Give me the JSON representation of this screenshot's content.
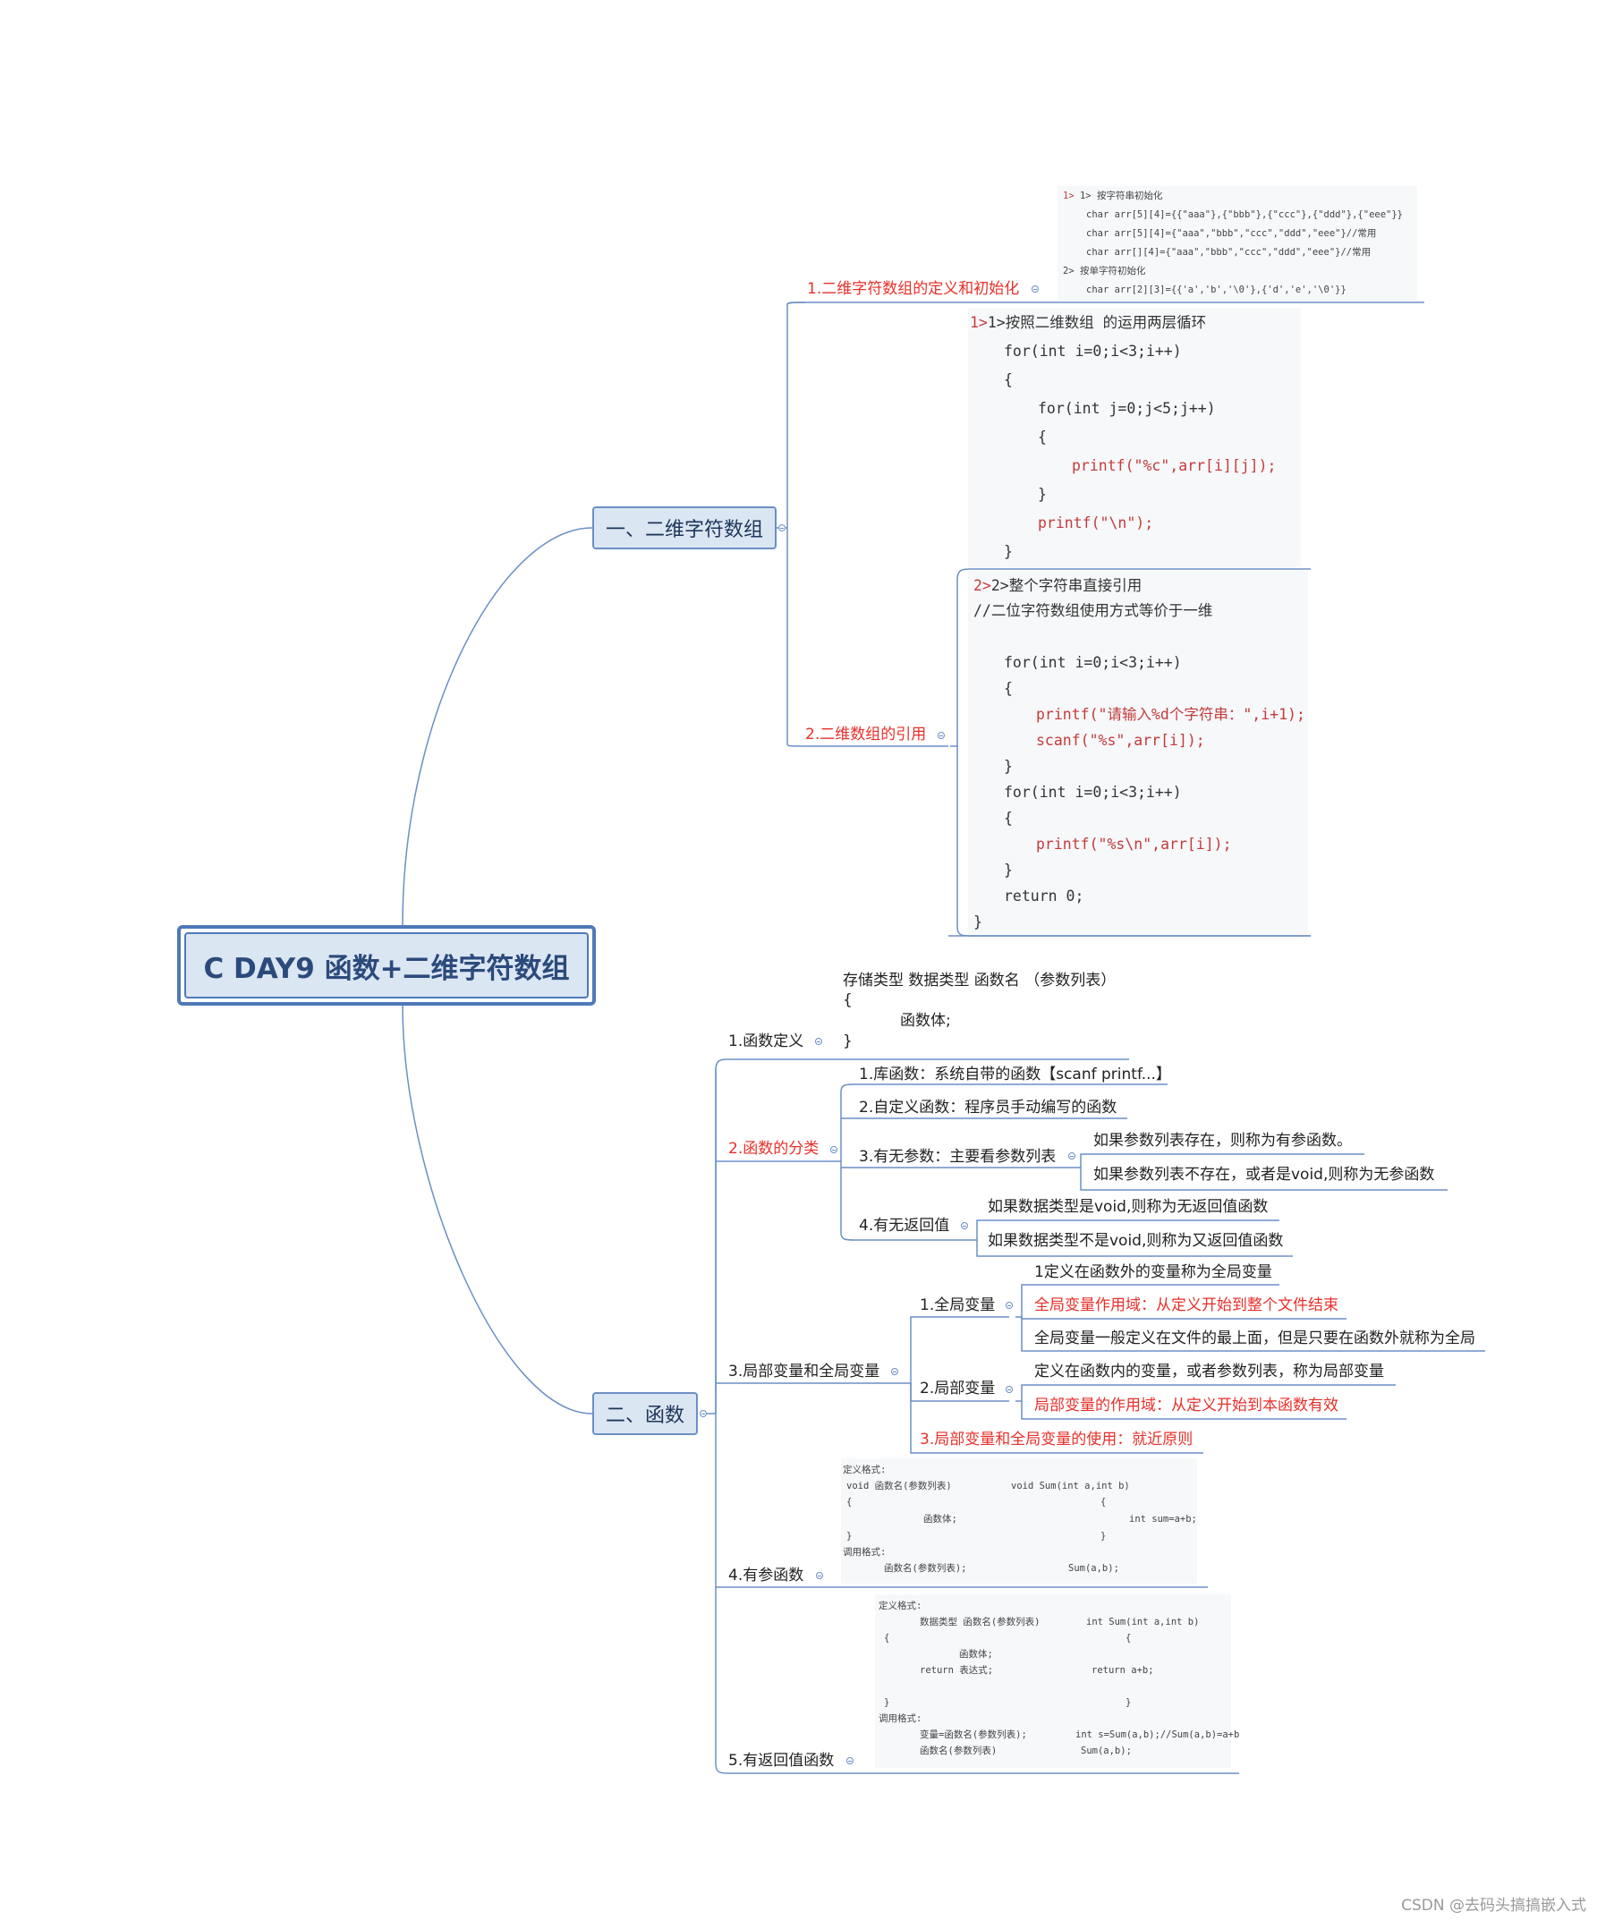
{
  "root": "C DAY9 函数+二维字符数组",
  "branch1": {
    "title": "一、二维字符数组",
    "child1": {
      "label": "1.二维字符数组的定义和初始化",
      "code": [
        "1> 按字符串初始化",
        "char arr[5][4]={{\"aaa\"},{\"bbb\"},{\"ccc\"},{\"ddd\"},{\"eee\"}}",
        "char arr[5][4]={\"aaa\",\"bbb\",\"ccc\",\"ddd\",\"eee\"}//常用",
        "char arr[][4]={\"aaa\",\"bbb\",\"ccc\",\"ddd\",\"eee\"}//常用",
        "2> 按单字符初始化",
        "char arr[2][3]={{'a','b','\\0'},{'d','e','\\0'}}"
      ]
    },
    "child2": {
      "label": "2.二维数组的引用",
      "code1": {
        "heading": "1>按照二维数组 的运用两层循环",
        "lines": [
          "for(int i=0;i<3;i++)",
          "{",
          "for(int j=0;j<5;j++)",
          "{",
          "printf(\"%c\",arr[i][j]);",
          "}",
          "printf(\"\\n\");",
          "}"
        ]
      },
      "code2": {
        "heading": "2>整个字符串直接引用",
        "comment": "//二位字符数组使用方式等价于一维",
        "lines": [
          "for(int i=0;i<3;i++)",
          "{",
          "printf(\"请输入%d个字符串：\",i+1);",
          "scanf(\"%s\",arr[i]);",
          "}",
          "for(int i=0;i<3;i++)",
          "{",
          "printf(\"%s\\n\",arr[i]);",
          "}",
          "return 0;",
          "}"
        ]
      }
    }
  },
  "branch2": {
    "title": "二、函数",
    "def": {
      "label": "1.函数定义",
      "lines": [
        "存储类型 数据类型 函数名 （参数列表）",
        "{",
        "函数体;",
        "}"
      ]
    },
    "classify": {
      "label": "2.函数的分类",
      "items": [
        "1.库函数：系统自带的函数【scanf printf...】",
        "2.自定义函数：程序员手动编写的函数"
      ],
      "params": {
        "label": "3.有无参数：主要看参数列表",
        "items": [
          "如果参数列表存在，则称为有参函数。",
          "如果参数列表不存在，或者是void,则称为无参函数"
        ]
      },
      "returns": {
        "label": "4.有无返回值",
        "items": [
          "如果数据类型是void,则称为无返回值函数",
          "如果数据类型不是void,则称为又返回值函数"
        ]
      }
    },
    "scope": {
      "label": "3.局部变量和全局变量",
      "global": {
        "label": "1.全局变量",
        "items": [
          "1定义在函数外的变量称为全局变量",
          "全局变量作用域：从定义开始到整个文件结束",
          "全局变量一般定义在文件的最上面，但是只要在函数外就称为全局"
        ]
      },
      "local": {
        "label": "2.局部变量",
        "items": [
          "定义在函数内的变量，或者参数列表，称为局部变量",
          "局部变量的作用域：从定义开始到本函数有效"
        ]
      },
      "rule": "3.局部变量和全局变量的使用：就近原则"
    },
    "param_fn": {
      "label": "4.有参函数",
      "left": [
        "定义格式:",
        "void 函数名(参数列表)",
        "{",
        "函数体;",
        "}",
        "调用格式:",
        "函数名(参数列表);"
      ],
      "right": [
        "void Sum(int a,int b)",
        "{",
        "int sum=a+b;",
        "}",
        "Sum(a,b);"
      ]
    },
    "return_fn": {
      "label": "5.有返回值函数",
      "left": [
        "定义格式:",
        "数据类型 函数名(参数列表)",
        "{",
        "函数体;",
        "return 表达式;",
        "}",
        "调用格式:",
        "变量=函数名(参数列表);",
        "函数名(参数列表)"
      ],
      "right": [
        "int Sum(int a,int b)",
        "{",
        "return a+b;",
        "}",
        "int s=Sum(a,b);//Sum(a,b)=a+b",
        "Sum(a,b);"
      ]
    }
  },
  "watermark": "CSDN @去码头搞搞嵌入式",
  "colors": {
    "line": "#6b8fc6",
    "accent_red": "#e8302a",
    "node_fill": "#dbe6f3"
  }
}
